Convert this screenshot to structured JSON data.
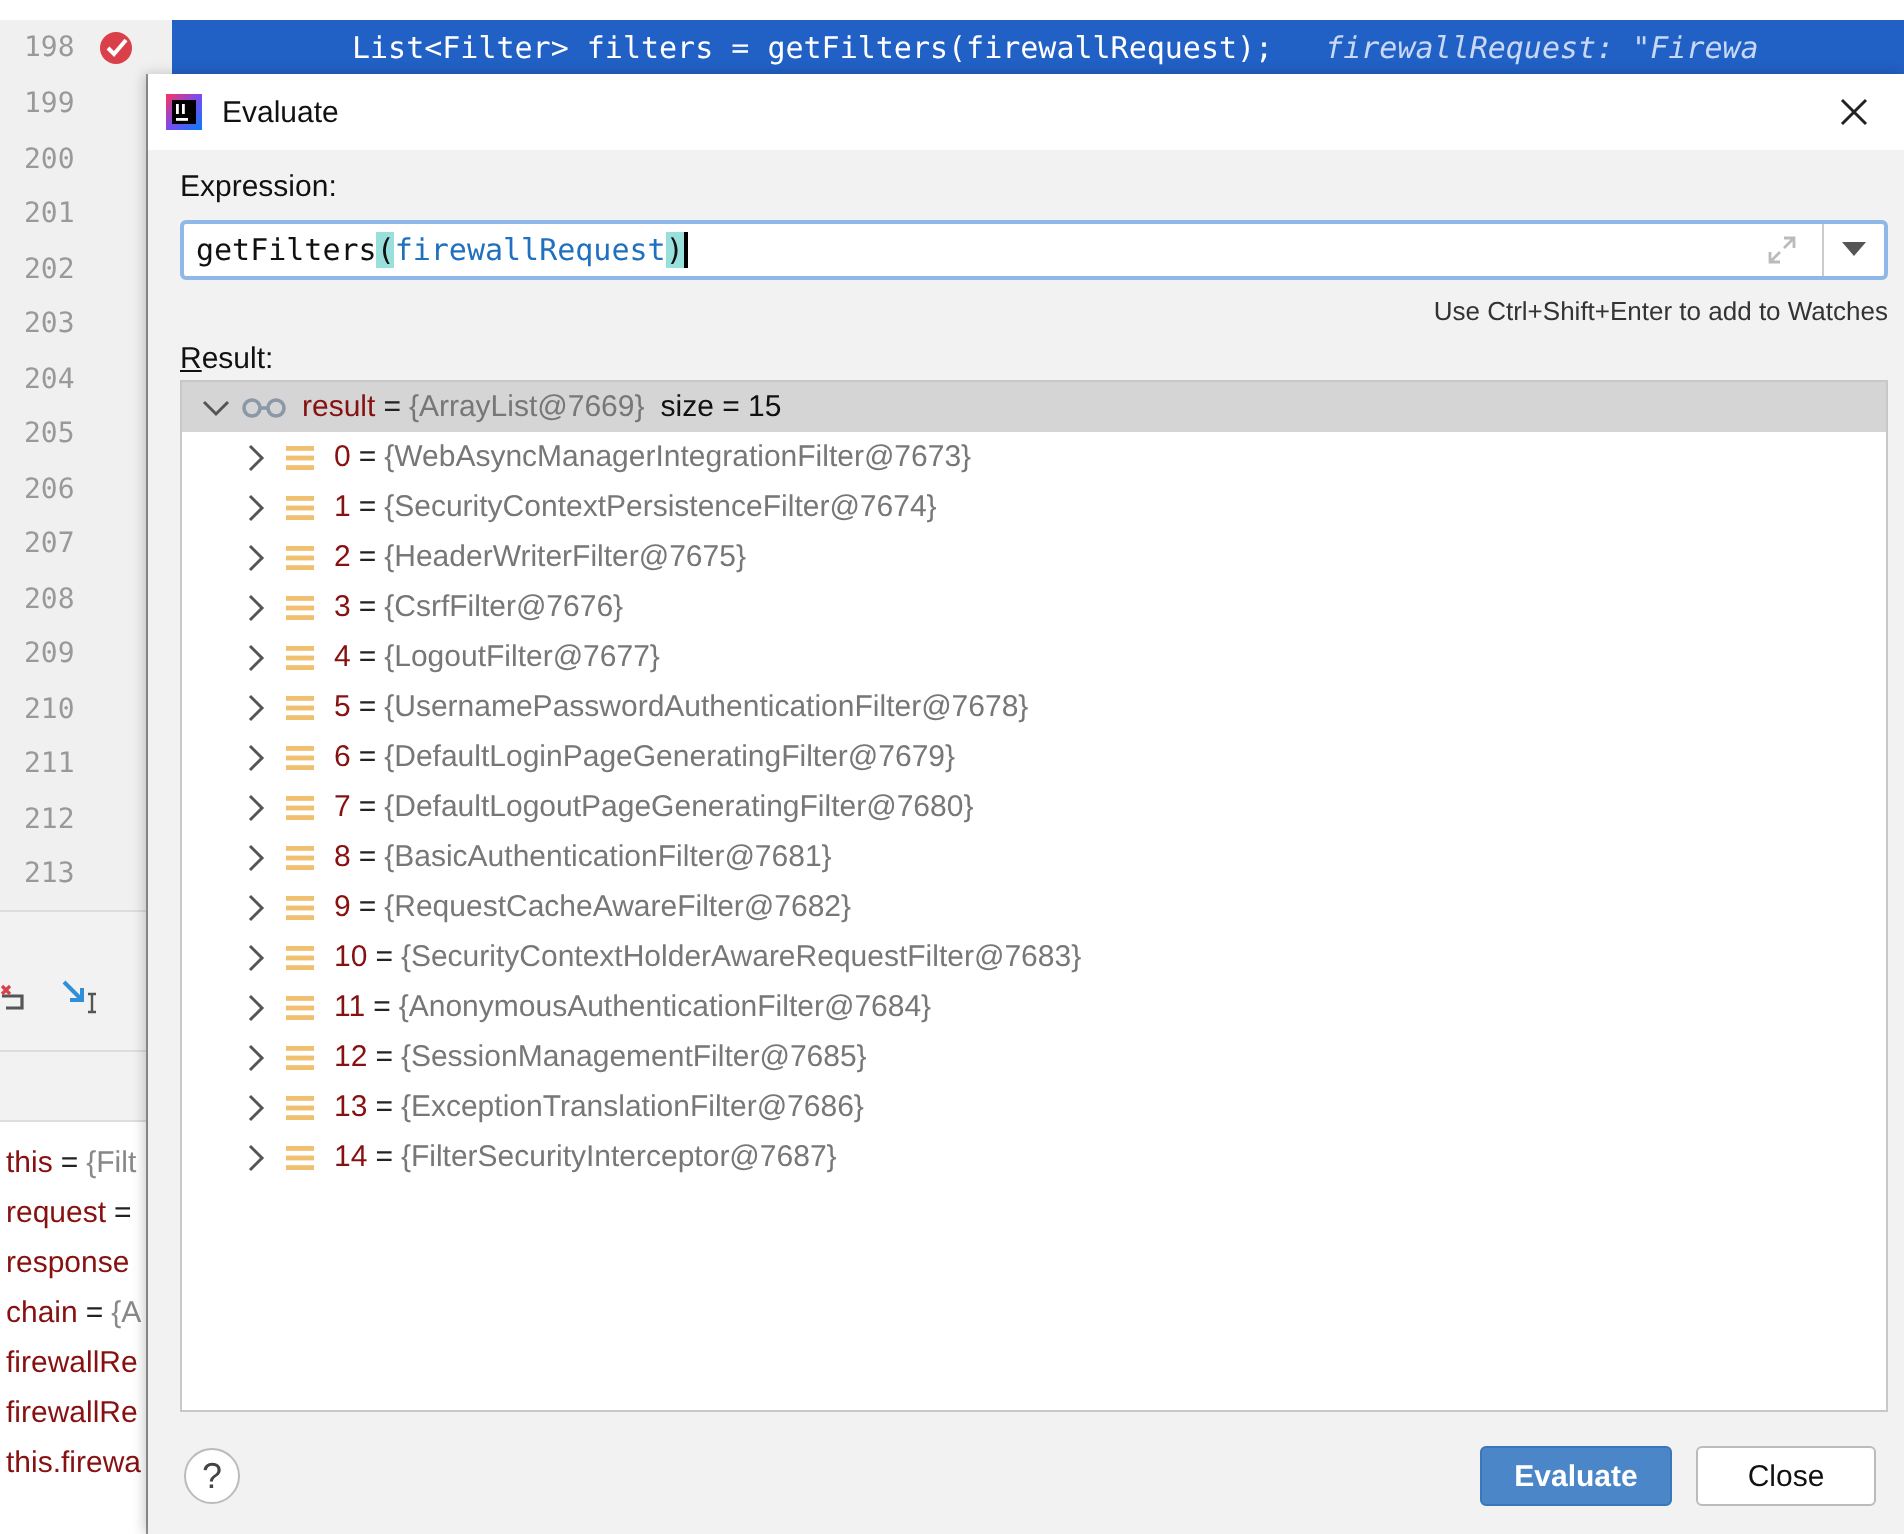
{
  "editor": {
    "current_line": {
      "number": "198",
      "breakpoint": true,
      "code": "List<Filter> filters = getFilters(firewallRequest);",
      "inline_hint": "firewallRequest: \"Firewa"
    },
    "line_numbers": [
      "199",
      "200",
      "201",
      "202",
      "203",
      "204",
      "205",
      "206",
      "207",
      "208",
      "209",
      "210",
      "211",
      "212",
      "213"
    ]
  },
  "variables": [
    {
      "name": "this",
      "eq": "=",
      "value": "{Filt"
    },
    {
      "name": "request",
      "eq": "="
    },
    {
      "name": "response"
    },
    {
      "name": "chain",
      "eq": "=",
      "value": "{A"
    },
    {
      "name": "firewallRe"
    },
    {
      "name": "firewallRe"
    },
    {
      "name": "this.firewa"
    }
  ],
  "dialog": {
    "title": "Evaluate",
    "expression_label": "Expression:",
    "expression": [
      {
        "text": "getFilters",
        "kind": "plain"
      },
      {
        "text": "(",
        "kind": "paren"
      },
      {
        "text": "firewallRequest",
        "kind": "variable"
      },
      {
        "text": ")",
        "kind": "paren"
      }
    ],
    "hint": "Use Ctrl+Shift+Enter to add to Watches",
    "result_label": "Result:",
    "result": {
      "name": "result",
      "eq": "=",
      "value": "{ArrayList@7669}",
      "extra": "size = 15",
      "expanded": true,
      "selected": true,
      "children": [
        {
          "name": "0",
          "eq": "=",
          "value": "{WebAsyncManagerIntegrationFilter@7673}",
          "expanded": false
        },
        {
          "name": "1",
          "eq": "=",
          "value": "{SecurityContextPersistenceFilter@7674}",
          "expanded": false
        },
        {
          "name": "2",
          "eq": "=",
          "value": "{HeaderWriterFilter@7675}",
          "expanded": false
        },
        {
          "name": "3",
          "eq": "=",
          "value": "{CsrfFilter@7676}",
          "expanded": false
        },
        {
          "name": "4",
          "eq": "=",
          "value": "{LogoutFilter@7677}",
          "expanded": false
        },
        {
          "name": "5",
          "eq": "=",
          "value": "{UsernamePasswordAuthenticationFilter@7678}",
          "expanded": false
        },
        {
          "name": "6",
          "eq": "=",
          "value": "{DefaultLoginPageGeneratingFilter@7679}",
          "expanded": false
        },
        {
          "name": "7",
          "eq": "=",
          "value": "{DefaultLogoutPageGeneratingFilter@7680}",
          "expanded": false
        },
        {
          "name": "8",
          "eq": "=",
          "value": "{BasicAuthenticationFilter@7681}",
          "expanded": false
        },
        {
          "name": "9",
          "eq": "=",
          "value": "{RequestCacheAwareFilter@7682}",
          "expanded": false
        },
        {
          "name": "10",
          "eq": "=",
          "value": "{SecurityContextHolderAwareRequestFilter@7683}",
          "expanded": false
        },
        {
          "name": "11",
          "eq": "=",
          "value": "{AnonymousAuthenticationFilter@7684}",
          "expanded": false
        },
        {
          "name": "12",
          "eq": "=",
          "value": "{SessionManagementFilter@7685}",
          "expanded": false
        },
        {
          "name": "13",
          "eq": "=",
          "value": "{ExceptionTranslationFilter@7686}",
          "expanded": false
        },
        {
          "name": "14",
          "eq": "=",
          "value": "{FilterSecurityInterceptor@7687}",
          "expanded": false
        }
      ]
    },
    "help": "?",
    "buttons": [
      {
        "label": "Evaluate",
        "kind": "primary"
      },
      {
        "label": "Close",
        "kind": "secondary"
      }
    ]
  }
}
